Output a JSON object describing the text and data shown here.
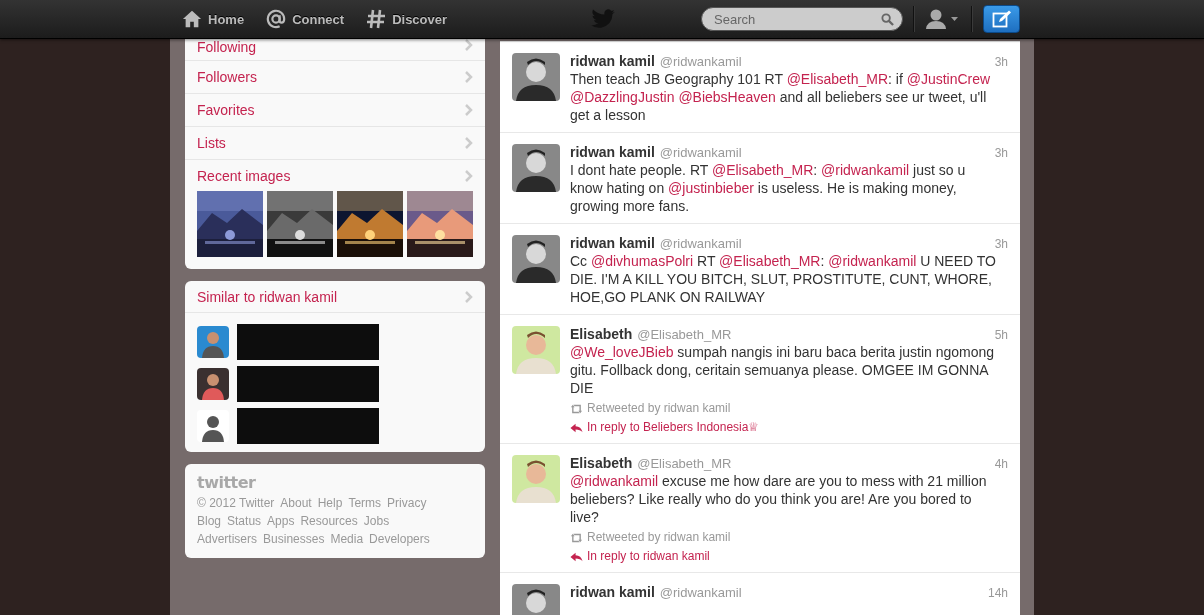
{
  "nav": {
    "items": [
      {
        "label": "Home"
      },
      {
        "label": "Connect"
      },
      {
        "label": "Discover"
      }
    ]
  },
  "search": {
    "placeholder": "Search"
  },
  "sidebar": {
    "items": [
      "Following",
      "Followers",
      "Favorites",
      "Lists",
      "Recent images"
    ]
  },
  "similar": {
    "title": "Similar to ridwan kamil",
    "users": [
      {
        "kind": "redacted"
      },
      {
        "kind": "redacted"
      },
      {
        "kind": "redacted"
      }
    ]
  },
  "footer": {
    "logo": "twitter",
    "lines": [
      [
        "© 2012 Twitter",
        "About",
        "Help",
        "Terms",
        "Privacy"
      ],
      [
        "Blog",
        "Status",
        "Apps",
        "Resources",
        "Jobs"
      ],
      [
        "Advertisers",
        "Businesses",
        "Media",
        "Developers"
      ]
    ]
  },
  "tweets": [
    {
      "name": "ridwan kamil",
      "handle": "@ridwankamil",
      "time": "3h",
      "parts": [
        {
          "kind": "text",
          "text": "Then teach JB Geography 101 RT "
        },
        {
          "kind": "link",
          "text": "@Elisabeth_MR"
        },
        {
          "kind": "text",
          "text": ": if "
        },
        {
          "kind": "link",
          "text": "@JustinCrew"
        },
        {
          "kind": "link",
          "text": "@DazzlingJustin"
        },
        {
          "kind": "link",
          "text": "@BiebsHeaven"
        },
        {
          "kind": "text",
          "text": " and all beliebers see ur tweet, u'll get a lesson"
        }
      ]
    },
    {
      "name": "ridwan kamil",
      "handle": "@ridwankamil",
      "time": "3h",
      "parts": [
        {
          "kind": "text",
          "text": "I dont hate people. RT "
        },
        {
          "kind": "link",
          "text": "@Elisabeth_MR"
        },
        {
          "kind": "text",
          "text": ": "
        },
        {
          "kind": "link",
          "text": "@ridwankamil"
        },
        {
          "kind": "text",
          "text": " just so u know hating on "
        },
        {
          "kind": "link",
          "text": "@justinbieber"
        },
        {
          "kind": "text",
          "text": " is useless. He is making money, growing more fans."
        }
      ]
    },
    {
      "name": "ridwan kamil",
      "handle": "@ridwankamil",
      "time": "3h",
      "parts": [
        {
          "kind": "text",
          "text": "Cc "
        },
        {
          "kind": "link",
          "text": "@divhumasPolri"
        },
        {
          "kind": "text",
          "text": " RT "
        },
        {
          "kind": "link",
          "text": "@Elisabeth_MR"
        },
        {
          "kind": "text",
          "text": ": "
        },
        {
          "kind": "link",
          "text": "@ridwankamil"
        },
        {
          "kind": "text",
          "text": " U NEED TO DIE. I'M A KILL YOU BITCH, SLUT, PROSTITUTE, CUNT, WHORE, HOE,GO PLANK ON RAILWAY"
        }
      ]
    },
    {
      "name": "Elisabeth",
      "handle": "@Elisabeth_MR",
      "time": "5h",
      "parts": [
        {
          "kind": "link",
          "text": "@We_loveJBieb"
        },
        {
          "kind": "text",
          "text": " sumpah nangis ini baru baca berita justin ngomong gitu. Follback dong, ceritain semuanya please. OMGEE IM GONNA DIE"
        }
      ],
      "retweeted_by": "Retweeted by ridwan kamil",
      "in_reply_to": "In reply to Beliebers Indonesia♕"
    },
    {
      "name": "Elisabeth",
      "handle": "@Elisabeth_MR",
      "time": "4h",
      "parts": [
        {
          "kind": "link",
          "text": "@ridwankamil"
        },
        {
          "kind": "text",
          "text": " excuse me how dare are you to mess with 21 million beliebers? Like really who do you think you are! Are you bored to live?"
        }
      ],
      "retweeted_by": "Retweeted by ridwan kamil",
      "in_reply_to": "In reply to ridwan kamil"
    },
    {
      "name": "ridwan kamil",
      "handle": "@ridwankamil",
      "time": "14h"
    }
  ]
}
